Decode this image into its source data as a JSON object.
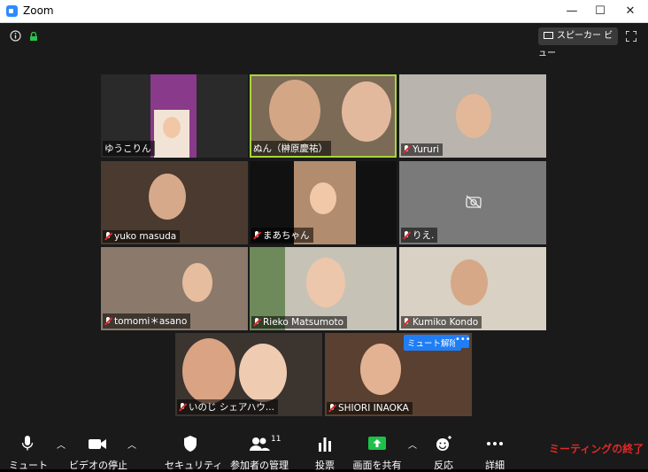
{
  "window": {
    "title": "Zoom",
    "minimize": "—",
    "maximize": "☐",
    "close": "✕"
  },
  "top": {
    "view_label": "スピーカー ビュー"
  },
  "participants": [
    "ゆうこりん",
    "ぬん（榊原慶祐）",
    "Yururi",
    "yuko masuda",
    "まあちゃん",
    "りえ.",
    "tomomi＊asano",
    "Rieko Matsumoto",
    "Kumiko Kondo",
    "いのじ シェアハウ...",
    "SHIORI INAOKA"
  ],
  "hover": {
    "unmute_label": "ミュート解除",
    "more_label": "•••"
  },
  "toolbar": {
    "mute": "ミュート",
    "video": "ビデオの停止",
    "security": "セキュリティ",
    "participants": "参加者の管理",
    "participants_count": "11",
    "poll": "投票",
    "share": "画面を共有",
    "reactions": "反応",
    "more": "詳細",
    "end": "ミーティングの終了"
  },
  "colors": {
    "accent": "#2d8cff",
    "end": "#e02828",
    "share": "#1ec04a",
    "active_speaker": "#a6d63a"
  }
}
